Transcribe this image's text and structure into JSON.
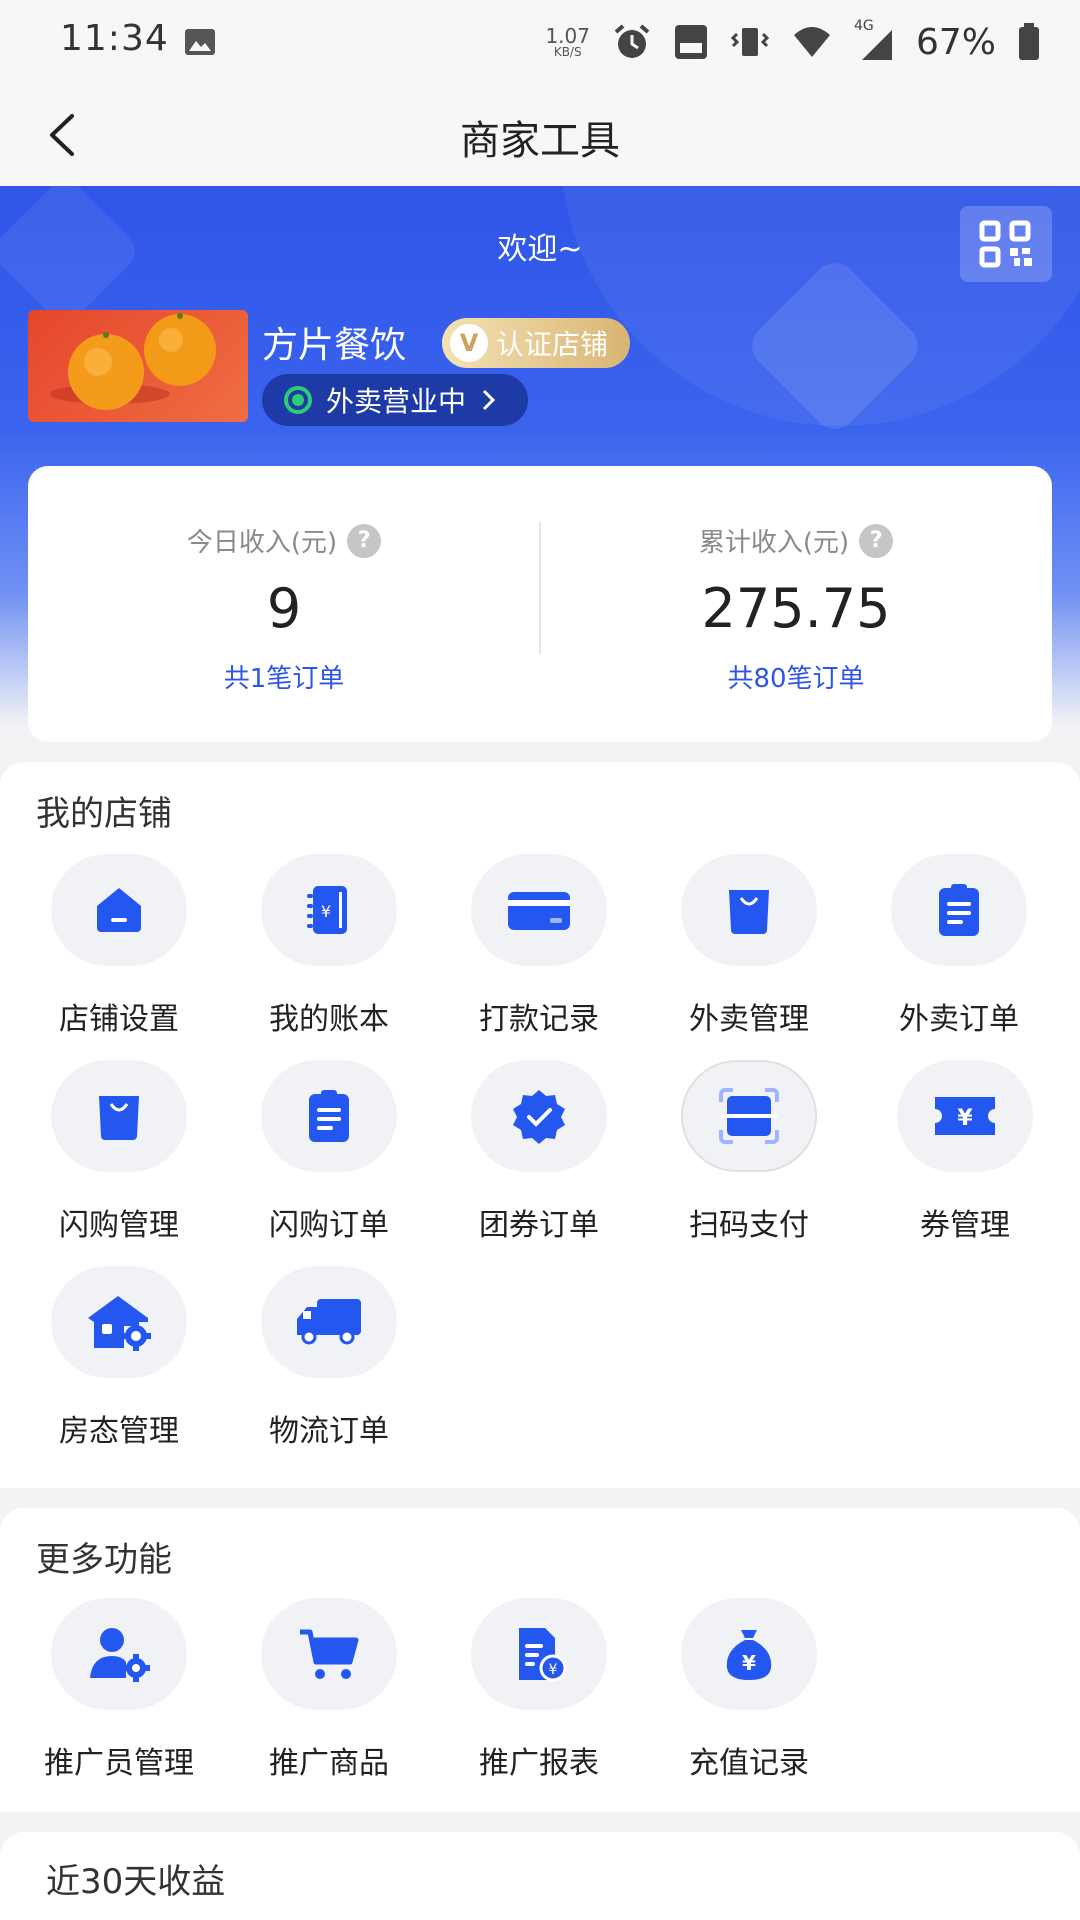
{
  "status_bar": {
    "time": "11:34",
    "net_speed_value": "1.07",
    "net_speed_unit": "KB/S",
    "network_type": "4G",
    "battery": "67%"
  },
  "header": {
    "title": "商家工具"
  },
  "banner": {
    "welcome": "欢迎~",
    "shop_name": "方片餐饮",
    "verified_badge": "认证店铺",
    "verified_mark": "V",
    "status_label": "外卖营业中"
  },
  "income": {
    "today_label": "今日收入(元)",
    "today_value": "9",
    "today_orders": "共1笔订单",
    "total_label": "累计收入(元)",
    "total_value": "275.75",
    "total_orders": "共80笔订单",
    "help_mark": "?"
  },
  "my_shop": {
    "title": "我的店铺",
    "items": [
      {
        "label": "店铺设置",
        "icon": "shop-icon"
      },
      {
        "label": "我的账本",
        "icon": "ledger-icon"
      },
      {
        "label": "打款记录",
        "icon": "card-icon"
      },
      {
        "label": "外卖管理",
        "icon": "bag-icon"
      },
      {
        "label": "外卖订单",
        "icon": "clipboard-icon"
      },
      {
        "label": "闪购管理",
        "icon": "bag-icon"
      },
      {
        "label": "闪购订单",
        "icon": "clipboard-icon"
      },
      {
        "label": "团券订单",
        "icon": "badge-check-icon"
      },
      {
        "label": "扫码支付",
        "icon": "scan-icon"
      },
      {
        "label": "券管理",
        "icon": "ticket-icon"
      },
      {
        "label": "房态管理",
        "icon": "house-gear-icon"
      },
      {
        "label": "物流订单",
        "icon": "truck-icon"
      }
    ]
  },
  "more": {
    "title": "更多功能",
    "items": [
      {
        "label": "推广员管理",
        "icon": "user-gear-icon"
      },
      {
        "label": "推广商品",
        "icon": "cart-icon"
      },
      {
        "label": "推广报表",
        "icon": "report-icon"
      },
      {
        "label": "充值记录",
        "icon": "money-bag-icon"
      }
    ]
  },
  "earnings": {
    "title": "近30天收益"
  },
  "colors": {
    "accent": "#2f55e8",
    "icon_blue": "#2357f0",
    "status_green": "#2ecc71",
    "badge_gold": "#d9b574"
  }
}
